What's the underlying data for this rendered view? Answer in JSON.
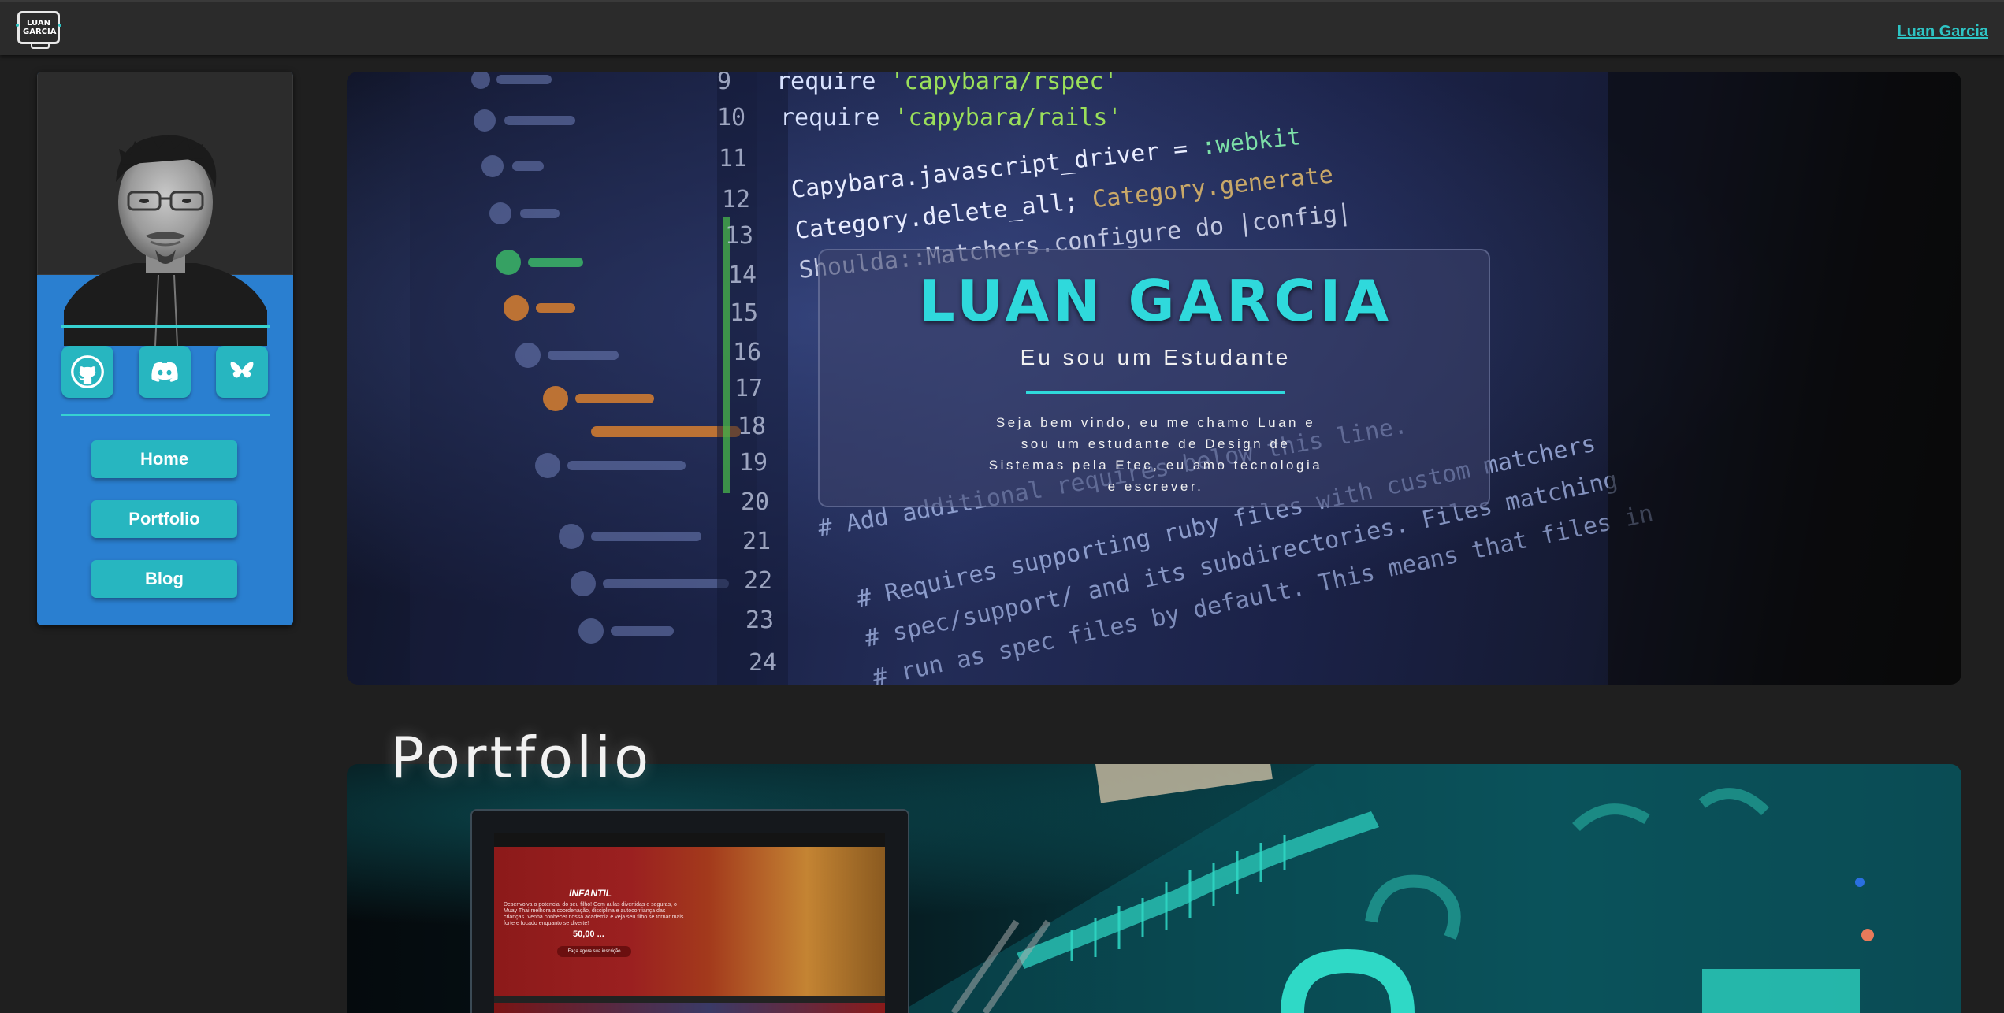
{
  "header": {
    "logo_text": "LUAN GARCIA",
    "right_link": "Luan Garcia"
  },
  "sidebar": {
    "social": [
      {
        "name": "github-icon"
      },
      {
        "name": "discord-icon"
      },
      {
        "name": "bluesky-icon"
      }
    ],
    "nav": {
      "home": "Home",
      "portfolio": "Portfolio",
      "blog": "Blog"
    }
  },
  "hero": {
    "title": "LUAN GARCIA",
    "subtitle": "Eu sou um Estudante",
    "description": "Seja bem vindo, eu me chamo Luan e sou um estudante de Design de Sistemas pela Etec, eu amo tecnologia e escrever."
  },
  "portfolio": {
    "title": "Portfolio",
    "preview": {
      "heading": "INFANTIL",
      "text": "Desenvolva o potencial do seu filho! Com aulas divertidas e seguras, o Muay Thai melhora a coordenação, disciplina e autoconfiança das crianças. Venha conhecer nossa academia e veja seu filho se tornar mais forte e focado enquanto se diverte!",
      "price": "50,00 ...",
      "button": "Faça agora sua inscrição"
    }
  },
  "colors": {
    "accent": "#2fd9dc",
    "sidebar_bg": "#2a7fd0",
    "button_bg": "#27b6c0",
    "page_bg": "#1f1f1f"
  }
}
